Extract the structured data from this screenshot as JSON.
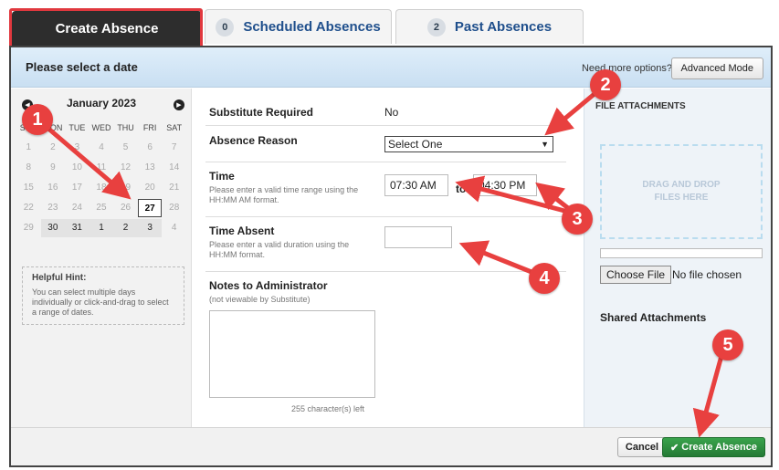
{
  "tabs": [
    {
      "label": "Create Absence",
      "count": ""
    },
    {
      "label": "Scheduled Absences",
      "count": "0"
    },
    {
      "label": "Past Absences",
      "count": "2"
    }
  ],
  "header": {
    "title": "Please select a date",
    "need_more": "Need more options?",
    "advanced_mode": "Advanced Mode"
  },
  "calendar": {
    "month": "January 2023",
    "weekdays": [
      "SUN",
      "MON",
      "TUE",
      "WED",
      "THU",
      "FRI",
      "SAT"
    ],
    "weeks": [
      [
        "1",
        "2",
        "3",
        "4",
        "5",
        "6",
        "7"
      ],
      [
        "8",
        "9",
        "10",
        "11",
        "12",
        "13",
        "14"
      ],
      [
        "15",
        "16",
        "17",
        "18",
        "19",
        "20",
        "21"
      ],
      [
        "22",
        "23",
        "24",
        "25",
        "26",
        "27",
        "28"
      ],
      [
        "29",
        "30",
        "31",
        "1",
        "2",
        "3",
        "4"
      ]
    ],
    "selected": "27"
  },
  "hint": {
    "title": "Helpful Hint:",
    "text": "You can select multiple days individually or click-and-drag to select a range of dates."
  },
  "form": {
    "substitute_label": "Substitute Required",
    "substitute_value": "No",
    "reason_label": "Absence Reason",
    "reason_value": "Select One",
    "time_label": "Time",
    "time_help": "Please enter a valid time range using the HH:MM AM format.",
    "time_start": "07:30 AM",
    "time_to": "to",
    "time_end": "04:30 PM",
    "absent_label": "Time Absent",
    "absent_help": "Please enter a valid duration using the HH:MM format.",
    "absent_value": "",
    "notes_label": "Notes to Administrator",
    "notes_sub": "(not viewable by Substitute)",
    "chars_left": "255 character(s) left"
  },
  "files": {
    "heading": "FILE ATTACHMENTS",
    "drop_text": "DRAG AND DROP FILES HERE",
    "choose_file": "Choose File",
    "no_file": "No file chosen",
    "shared": "Shared Attachments"
  },
  "footer": {
    "cancel": "Cancel",
    "create": "Create Absence"
  },
  "annotations": [
    "1",
    "2",
    "3",
    "4",
    "5"
  ],
  "colors": {
    "annotation_red": "#e8403f",
    "create_green": "#2e8b3e",
    "header_blue": "#cfe3f5"
  }
}
